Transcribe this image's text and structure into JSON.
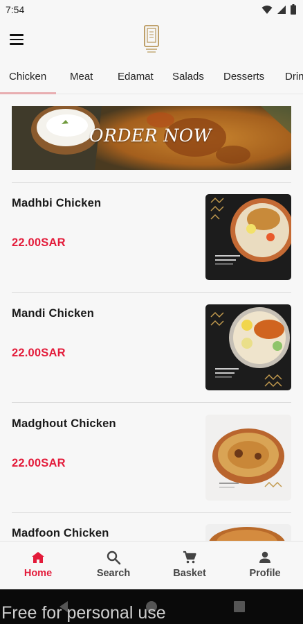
{
  "status_bar": {
    "time": "7:54",
    "icons": [
      "wifi-icon",
      "signal-icon",
      "battery-icon"
    ]
  },
  "app_bar": {
    "menu_icon": "hamburger-menu-icon",
    "logo": "restaurant-logo"
  },
  "tabs": [
    {
      "label": "Chicken",
      "active": true
    },
    {
      "label": "Meat",
      "active": false
    },
    {
      "label": "Edamat",
      "active": false
    },
    {
      "label": "Salads",
      "active": false
    },
    {
      "label": "Desserts",
      "active": false
    },
    {
      "label": "Drin",
      "active": false
    }
  ],
  "banner": {
    "text": "ORDER NOW"
  },
  "items": [
    {
      "name": "Madhbi Chicken",
      "price": "22.00SAR"
    },
    {
      "name": "Mandi Chicken",
      "price": "22.00SAR"
    },
    {
      "name": "Madghout Chicken",
      "price": "22.00SAR"
    },
    {
      "name": "Madfoon Chicken",
      "price": ""
    }
  ],
  "bottom_nav": [
    {
      "label": "Home",
      "icon": "home-icon",
      "active": true
    },
    {
      "label": "Search",
      "icon": "search-icon",
      "active": false
    },
    {
      "label": "Basket",
      "icon": "cart-icon",
      "active": false
    },
    {
      "label": "Profile",
      "icon": "person-icon",
      "active": false
    }
  ],
  "colors": {
    "accent": "#e31b3a",
    "tab_indicator": "#e8aeb1",
    "background": "#f7f7f7"
  },
  "watermark": "Free for personal use"
}
